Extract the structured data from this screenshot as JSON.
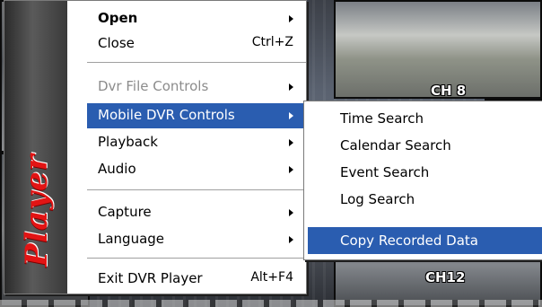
{
  "background": {
    "channel_labels": [
      "CH 8",
      "CH12"
    ]
  },
  "brand": {
    "text": "Player",
    "color": "#e21414"
  },
  "menu": {
    "items": [
      {
        "label": "Open",
        "shortcut": "",
        "submenu": true,
        "bold": true
      },
      {
        "label": "Close",
        "shortcut": "Ctrl+Z",
        "submenu": false
      },
      {
        "label": "Dvr File Controls",
        "shortcut": "",
        "submenu": true,
        "disabled": true
      },
      {
        "label": "Mobile DVR Controls",
        "shortcut": "",
        "submenu": true,
        "selected": true
      },
      {
        "label": "Playback",
        "shortcut": "",
        "submenu": true
      },
      {
        "label": "Audio",
        "shortcut": "",
        "submenu": true
      },
      {
        "label": "Capture",
        "shortcut": "",
        "submenu": true
      },
      {
        "label": "Language",
        "shortcut": "",
        "submenu": true
      },
      {
        "label": "Exit DVR Player",
        "shortcut": "Alt+F4",
        "submenu": false
      }
    ],
    "highlight_color": "#2a5db0"
  },
  "submenu": {
    "items": [
      {
        "label": "Time Search"
      },
      {
        "label": "Calendar Search"
      },
      {
        "label": "Event Search"
      },
      {
        "label": "Log Search"
      },
      {
        "label": "Copy Recorded Data",
        "selected": true
      }
    ]
  }
}
